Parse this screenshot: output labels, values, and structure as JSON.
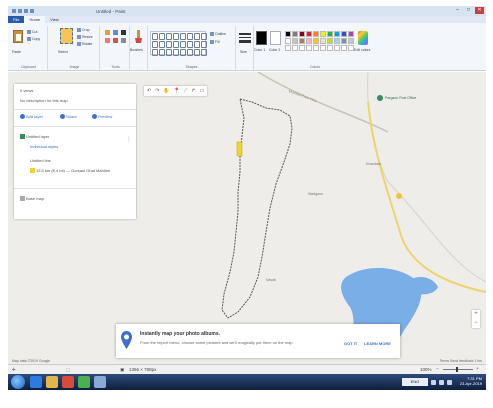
{
  "window": {
    "title": "Untitled - Paint",
    "controls": {
      "minimize": "–",
      "maximize": "□",
      "close": "✕"
    }
  },
  "ribbon": {
    "tabs": [
      {
        "label": "File"
      },
      {
        "label": "Home"
      },
      {
        "label": "View"
      }
    ],
    "groups": {
      "clipboard": {
        "label": "Clipboard",
        "paste": "Paste",
        "cut": "Cut",
        "copy": "Copy"
      },
      "image": {
        "label": "Image",
        "select": "Select",
        "crop": "Crop",
        "resize": "Resize",
        "rotate": "Rotate"
      },
      "tools": {
        "label": "Tools",
        "brushes": "Brushes"
      },
      "shapes": {
        "label": "Shapes",
        "outline": "Outline",
        "fill": "Fill"
      },
      "size": {
        "label": "Size"
      },
      "colors": {
        "label": "Colors",
        "color1": "Color 1",
        "color2": "Color 2",
        "edit": "Edit colors"
      }
    },
    "palette": [
      "#000000",
      "#7f7f7f",
      "#880015",
      "#ed1c24",
      "#ff7f27",
      "#fff200",
      "#22b14c",
      "#00a2e8",
      "#3f48cc",
      "#a349a4",
      "#ffffff",
      "#c3c3c3",
      "#b97a57",
      "#ffaec9",
      "#ffc90e",
      "#efe4b0",
      "#b5e61d",
      "#99d9ea",
      "#7092be",
      "#c8bfe7",
      "#ffffff",
      "#ffffff",
      "#ffffff",
      "#ffffff",
      "#ffffff",
      "#ffffff",
      "#ffffff",
      "#ffffff",
      "#ffffff",
      "#ffffff"
    ]
  },
  "map": {
    "panel": {
      "title_line": "0 views",
      "subtitle_line": "No description for this map",
      "actions": {
        "add_layer": "Add layer",
        "share": "Share",
        "preview": "Preview"
      },
      "layer_name": "Untitled layer",
      "layer_sub": "Individual styles",
      "item1": "Untitled line",
      "item2": "13.5 km (8.4 mi) — Gorsaul Ghat Mahthel",
      "base_map": "Base map"
    },
    "labels": {
      "road": "Mumbai Pune Hwy",
      "poi": "Pargaon Post Office",
      "town1": "Khandala",
      "town2": "Wadgaon",
      "town3": "Navali"
    },
    "promo": {
      "title": "Instantly map your photo albums.",
      "body": "From the import menu, choose some pictures and we'll magically put them on the map",
      "got_it": "GOT IT",
      "learn_more": "LEARN MORE"
    },
    "footer_left": "Map data ©2019 Google",
    "footer_right": "Terms  Send feedback  1 km"
  },
  "statusbar": {
    "position": "",
    "selection": "",
    "size": "1366 × 768px",
    "zoom": "100%"
  },
  "taskbar": {
    "language": "ENG",
    "time": "7:31 PM",
    "date": "23-Apr-2019"
  },
  "colors": {
    "accent": "#2a5ba8",
    "route": "#666666",
    "water": "#7aaee6",
    "road": "#f0d36a"
  }
}
